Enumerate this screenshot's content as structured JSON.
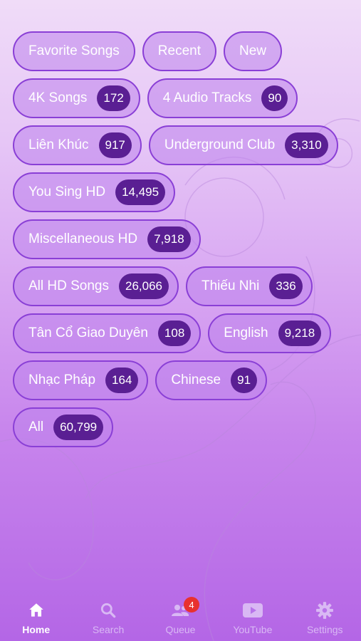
{
  "categories": [
    [
      {
        "name": "Favorite Songs"
      },
      {
        "name": "Recent"
      },
      {
        "name": "New"
      }
    ],
    [
      {
        "name": "4K Songs",
        "count": "172"
      },
      {
        "name": "4 Audio Tracks",
        "count": "90"
      }
    ],
    [
      {
        "name": "Liên Khúc",
        "count": "917"
      },
      {
        "name": "Underground Club",
        "count": "3,310"
      }
    ],
    [
      {
        "name": "You Sing HD",
        "count": "14,495"
      }
    ],
    [
      {
        "name": "Miscellaneous HD",
        "count": "7,918"
      }
    ],
    [
      {
        "name": "All HD Songs",
        "count": "26,066"
      },
      {
        "name": "Thiếu Nhi",
        "count": "336"
      }
    ],
    [
      {
        "name": "Tân Cổ Giao Duyên",
        "count": "108"
      },
      {
        "name": "English",
        "count": "9,218"
      }
    ],
    [
      {
        "name": "Nhạc Pháp",
        "count": "164"
      },
      {
        "name": "Chinese",
        "count": "91"
      }
    ],
    [
      {
        "name": "All",
        "count": "60,799"
      }
    ]
  ],
  "tabbar": {
    "home": {
      "label": "Home",
      "icon": "home-icon"
    },
    "search": {
      "label": "Search",
      "icon": "search-icon"
    },
    "queue": {
      "label": "Queue",
      "icon": "people-icon",
      "badge": "4"
    },
    "youtube": {
      "label": "YouTube",
      "icon": "youtube-icon"
    },
    "settings": {
      "label": "Settings",
      "icon": "gear-icon"
    }
  },
  "colors": {
    "chip_border": "#8a3fd6",
    "badge_bg": "#5a1f93",
    "queue_badge": "#e8312e"
  }
}
